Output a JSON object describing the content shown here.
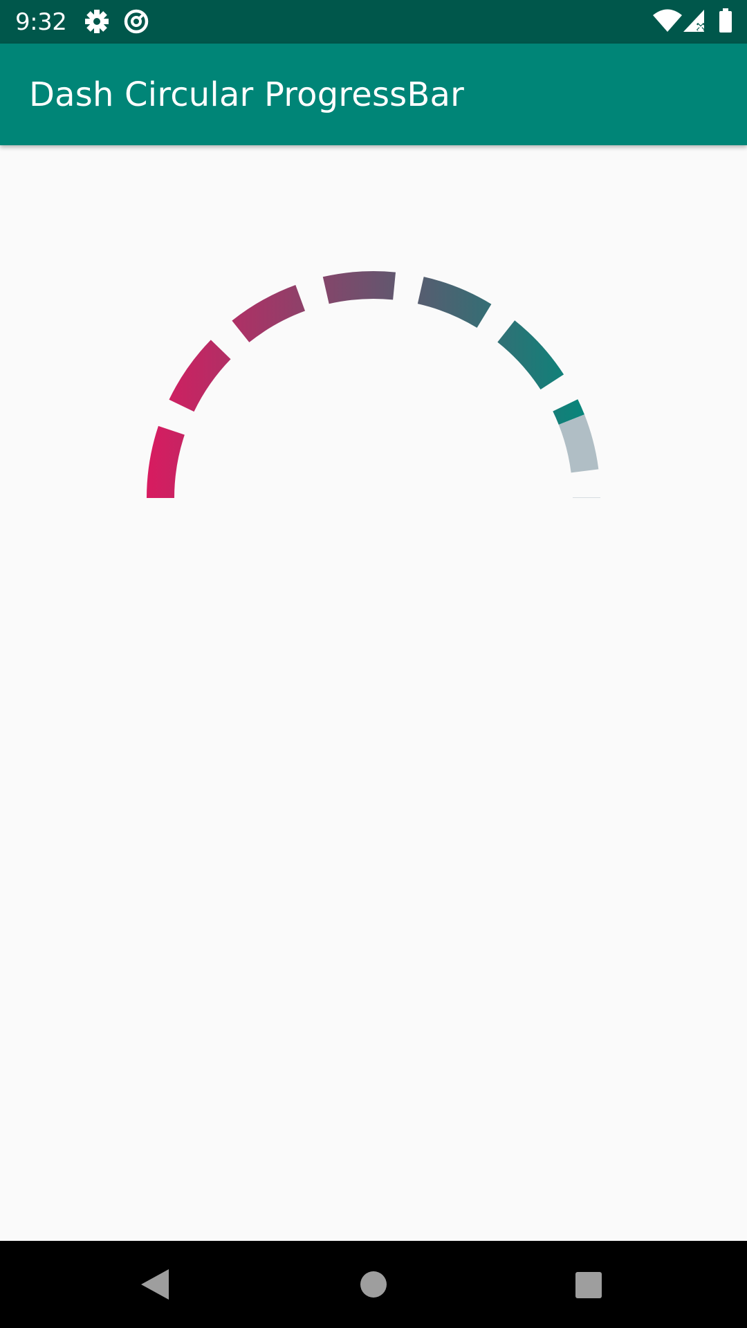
{
  "status_bar": {
    "time": "9:32",
    "left_icons": [
      "gear-icon",
      "data-saver-icon"
    ],
    "right_icons": [
      "wifi-icon",
      "signal-no-data-icon",
      "battery-icon"
    ]
  },
  "app_bar": {
    "title": "Dash Circular ProgressBar"
  },
  "progress_bar": {
    "style": "dashed-semicircle",
    "progress_fraction": 0.88,
    "gradient_start_color": "#d81b60",
    "gradient_end_color": "#00897b",
    "track_color": "#b0bec5"
  },
  "nav_bar": {
    "buttons": [
      "back",
      "home",
      "recents"
    ]
  }
}
